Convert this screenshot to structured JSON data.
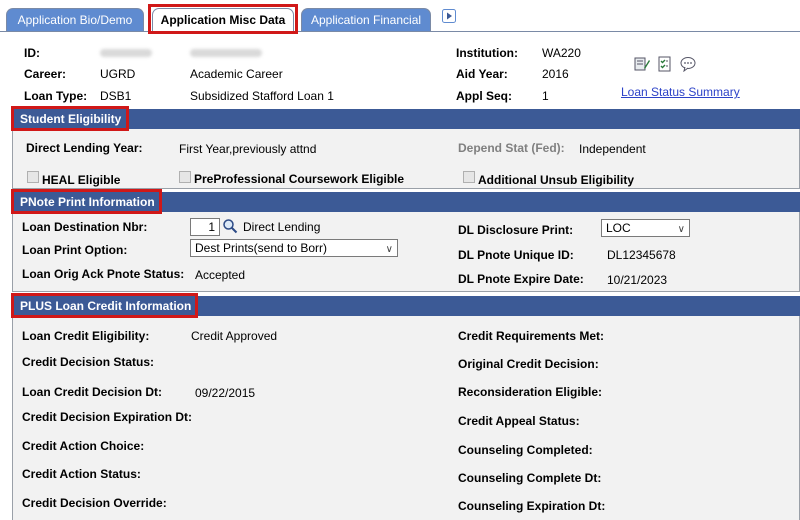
{
  "tabs": [
    {
      "label": "Application Bio/Demo"
    },
    {
      "label": "Application Misc Data"
    },
    {
      "label": "Application Financial"
    }
  ],
  "header": {
    "id_label": "ID:",
    "career_label": "Career:",
    "career_value": "UGRD",
    "career_desc": "Academic Career",
    "loan_type_label": "Loan Type:",
    "loan_type_value": "DSB1",
    "loan_type_desc": "Subsidized Stafford Loan 1",
    "institution_label": "Institution:",
    "institution_value": "WA220",
    "aid_year_label": "Aid Year:",
    "aid_year_value": "2016",
    "appl_seq_label": "Appl Seq:",
    "appl_seq_value": "1",
    "loan_status_link": "Loan Status Summary"
  },
  "student_eligibility": {
    "title": "Student Eligibility",
    "direct_lending_year_label": "Direct Lending Year:",
    "direct_lending_year_value": "First Year,previously attnd",
    "depend_stat_label": "Depend Stat (Fed):",
    "depend_stat_value": "Independent",
    "heal_label": "HEAL Eligible",
    "preprof_label": "PreProfessional Coursework Eligible",
    "addl_unsub_label": "Additional Unsub Eligibility"
  },
  "pnote": {
    "title": "PNote Print Information",
    "loan_dest_label": "Loan Destination Nbr:",
    "loan_dest_value": "1",
    "loan_dest_desc": "Direct Lending",
    "loan_print_label": "Loan Print Option:",
    "loan_print_value": "Dest Prints(send to Borr)",
    "orig_ack_label": "Loan Orig Ack Pnote Status:",
    "orig_ack_value": "Accepted",
    "dl_disclosure_label": "DL Disclosure Print:",
    "dl_disclosure_value": "LOC",
    "dl_unique_label": "DL Pnote Unique ID:",
    "dl_unique_value": "DL12345678",
    "dl_expire_label": "DL Pnote Expire Date:",
    "dl_expire_value": "10/21/2023"
  },
  "plus": {
    "title": "PLUS Loan Credit Information",
    "loan_credit_elig_label": "Loan Credit Eligibility:",
    "loan_credit_elig_value": "Credit Approved",
    "credit_decision_status_label": "Credit Decision Status:",
    "loan_credit_decision_dt_label": "Loan Credit Decision Dt:",
    "loan_credit_decision_dt_value": "09/22/2015",
    "credit_decision_exp_label": "Credit Decision Expiration Dt:",
    "credit_action_choice_label": "Credit Action Choice:",
    "credit_action_status_label": "Credit Action Status:",
    "credit_decision_override_label": "Credit Decision Override:",
    "credit_req_met_label": "Credit Requirements Met:",
    "original_credit_decision_label": "Original Credit Decision:",
    "reconsideration_label": "Reconsideration Eligible:",
    "credit_appeal_label": "Credit Appeal Status:",
    "counseling_completed_label": "Counseling Completed:",
    "counseling_complete_dt_label": "Counseling Complete Dt:",
    "counseling_expiration_label": "Counseling Expiration Dt:"
  },
  "colors": {
    "tab_bg": "#5f8bd0",
    "section_header_bg": "#3c5a96",
    "highlight_red": "#d01818",
    "link": "#2c42c8"
  },
  "icons": [
    "play-next-icon",
    "notepad-edit-icon",
    "checklist-icon",
    "comment-bubble-icon",
    "lookup-search-icon"
  ]
}
